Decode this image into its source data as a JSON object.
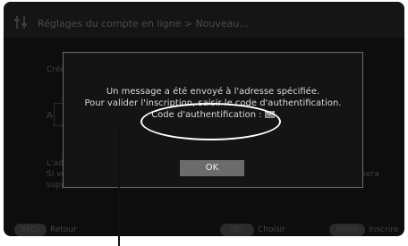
{
  "window": {
    "title": "Réglages du compte en ligne > Nouveau..."
  },
  "background": {
    "line_a": "Créer c",
    "line_b": "A",
    "line_c": "L'adre",
    "line_d": "Si vou",
    "line_e": "suppri",
    "line_f": "e sera"
  },
  "dialog": {
    "message_line1": "Un message a été envoyé à l'adresse spécifiée.",
    "message_line2": "Pour valider l'inscription, saisir le code d'authentification.",
    "message_line3": "Code d'authentification : ",
    "ok_label": "OK"
  },
  "footer": {
    "back_key": "BACK",
    "back_label": "Retour",
    "set_key": "SET",
    "set_label": "Choisir",
    "menu_key": "MENU",
    "menu_label": "Inscrire"
  }
}
